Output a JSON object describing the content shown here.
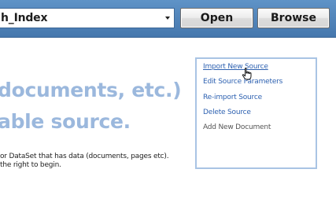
{
  "toolbar": {
    "index_select_value": "h_Index",
    "open_label": "Open",
    "browse_label": "Browse"
  },
  "main": {
    "heading_line1": "documents, etc.)",
    "heading_line2": "able source.",
    "description_line1": "or DataSet that has data (documents, pages etc).",
    "description_line2": "the right to begin."
  },
  "menu": {
    "items": [
      {
        "label": "Import New Source"
      },
      {
        "label": "Edit Source Parameters"
      },
      {
        "label": "Re-import Source"
      },
      {
        "label": "Delete Source"
      },
      {
        "label": "Add New Document"
      }
    ]
  },
  "colors": {
    "toolbar_bg": "#4f82b9",
    "heading": "#9bb8dd",
    "link": "#2f62b1",
    "menu_border": "#a9c4e4"
  },
  "icons": {
    "cursor": "hand-pointer-icon"
  }
}
